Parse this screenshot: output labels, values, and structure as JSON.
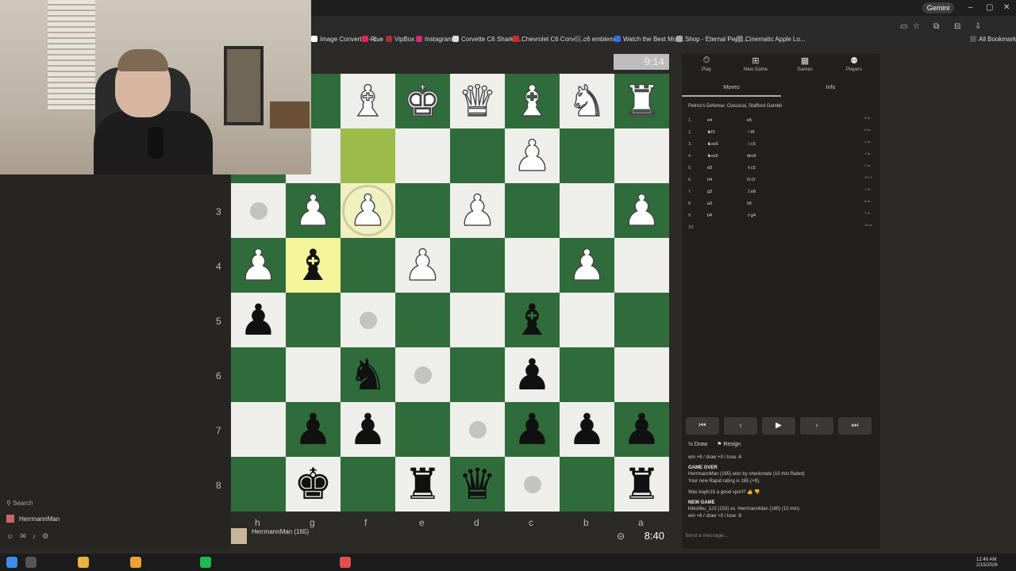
{
  "browser": {
    "gemini_label": "Gemini",
    "bookmarks": [
      {
        "label": "Image Converter - c...",
        "color": "#ffffff"
      },
      {
        "label": "Rive",
        "color": "#e0245e"
      },
      {
        "label": "VipBox",
        "color": "#a83232"
      },
      {
        "label": "Instagram",
        "color": "#d62976"
      },
      {
        "label": "Corvette C6 Sharkb...",
        "color": "#dddddd"
      },
      {
        "label": "Chevrolet C6 Corvet...",
        "color": "#cc2b2b"
      },
      {
        "label": "c6 emblems",
        "color": "#555555"
      },
      {
        "label": "Watch the Best Mov...",
        "color": "#3a6ee8"
      },
      {
        "label": "Shop - Eternal Pepti...",
        "color": "#aaaaaa"
      },
      {
        "label": "Cinematic Apple Lo...",
        "color": "#777777"
      }
    ],
    "all_bookmarks": "All Bookmarks"
  },
  "left": {
    "search_label": "Search",
    "user_label": "HerrmannMan"
  },
  "board": {
    "ranks": [
      "3",
      "4",
      "5",
      "6",
      "7",
      "8"
    ],
    "files": [
      "h",
      "g",
      "f",
      "e",
      "d",
      "c",
      "b",
      "a"
    ],
    "timer_top": "9:14",
    "timer_bottom": "8:40",
    "player_name": "HerrmannMan (165)"
  },
  "right": {
    "tabs": [
      "Play",
      "New Game",
      "Games",
      "Players"
    ],
    "subtabs": [
      "Moves",
      "Info"
    ],
    "opening": "Petrov's Defense: Classical, Stafford Gambit",
    "moves": [
      {
        "n": "1.",
        "w": "e4",
        "b": "e5",
        "t": "8.9s"
      },
      {
        "n": "2.",
        "w": "♞f3",
        "b": "♘f6",
        "t": "0.6s"
      },
      {
        "n": "3.",
        "w": "♞xe5",
        "b": "♘c6",
        "t": "3.1s"
      },
      {
        "n": "4.",
        "w": "♞xc6",
        "b": "dxc6",
        "t": "1.5s"
      },
      {
        "n": "5.",
        "w": "d3",
        "b": "♗c5",
        "t": "2.1s"
      },
      {
        "n": "6.",
        "w": "h4",
        "b": "O-O",
        "t": "10.7s"
      },
      {
        "n": "7.",
        "w": "g3",
        "b": "♖e8",
        "t": "1.6s"
      },
      {
        "n": "8.",
        "w": "a3",
        "b": "h5",
        "t": "6.3s"
      },
      {
        "n": "9.",
        "w": "b4",
        "b": "♗g4",
        "t": "7.7s"
      },
      {
        "n": "10.",
        "w": "",
        "b": "",
        "t": "10.4s"
      }
    ],
    "draw_label": "Draw",
    "resign_label": "Resign",
    "chat": {
      "line1": "win +8 / draw +0 / lose -8",
      "game_over": "GAME OVER",
      "line2": "HerrmannMan (165) won by checkmate (10 min Rated)",
      "line3": "Your new Rapid rating is 165 (+8).",
      "line4": "Was kayln15 a good sport?",
      "new_game": "NEW GAME",
      "line5": "hiteshku_123 (153) vs. HerrmannMan (165) (10 min)",
      "line6": "win +8 / draw +0 / lose -8"
    },
    "message_placeholder": "Send a message..."
  },
  "taskbar": {
    "time": "12:48 AM",
    "date": "2/15/2026"
  }
}
